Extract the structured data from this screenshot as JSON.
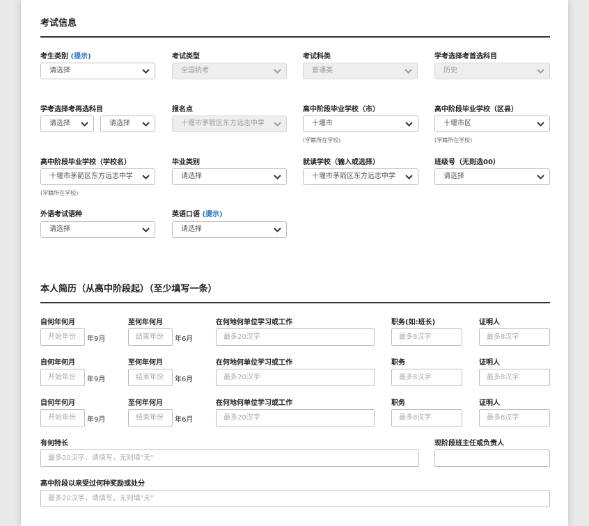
{
  "exam_info": {
    "title": "考试信息",
    "student_category": {
      "label": "考生类别",
      "hint_link": "提示",
      "value": "请选择"
    },
    "exam_type": {
      "label": "考试类型",
      "value": "全国统考"
    },
    "exam_subject": {
      "label": "考试科类",
      "value": "普通类"
    },
    "first_choice": {
      "label": "学考选择考首选科目",
      "value": "历史"
    },
    "second_choice": {
      "label": "学考选择考再选科目",
      "value1": "请选择",
      "value2": "请选择"
    },
    "registration_site": {
      "label": "报名点",
      "value": "十堰市茅箭区东方远志中学"
    },
    "hs_city": {
      "label": "高中阶段毕业学校（市）",
      "value": "十堰市",
      "hint": "(学籍所在学校)"
    },
    "hs_county": {
      "label": "高中阶段毕业学校（区县）",
      "value": "十堰市区",
      "hint": "(学籍所在学校)"
    },
    "hs_school": {
      "label": "高中阶段毕业学校（学校名）",
      "value": "十堰市茅箭区东方远志中学",
      "hint": "(学籍所在学校)"
    },
    "grad_category": {
      "label": "毕业类别",
      "value": "请选择"
    },
    "attend_school": {
      "label": "就读学校（输入或选择）",
      "value": "十堰市茅箭区东方远志中学"
    },
    "class_no": {
      "label": "班级号（无则选00）",
      "value": "请选择"
    },
    "foreign_lang": {
      "label": "外语考试语种",
      "value": "请选择"
    },
    "english_oral": {
      "label": "英语口语",
      "hint_link": "提示",
      "value": "请选择"
    }
  },
  "resume": {
    "title": "本人简历（从高中阶段起）（至少填写一条）",
    "rows": [
      {
        "from_label": "自何年何月",
        "from_placeholder": "开始年份",
        "from_suffix": "年9月",
        "to_label": "至何年何月",
        "to_placeholder": "结束年份",
        "to_suffix": "年6月",
        "where_label": "在何地何单位学习或工作",
        "where_placeholder": "最多20汉字",
        "post_label": "职务(如:班长)",
        "post_placeholder": "最多8汉字",
        "witness_label": "证明人",
        "witness_placeholder": "最多8汉字"
      },
      {
        "from_label": "自何年何月",
        "from_placeholder": "开始年份",
        "from_suffix": "年9月",
        "to_label": "至何年何月",
        "to_placeholder": "结束年份",
        "to_suffix": "年6月",
        "where_label": "在何地何单位学习或工作",
        "where_placeholder": "最多20汉字",
        "post_label": "职务",
        "post_placeholder": "最多8汉字",
        "witness_label": "证明人",
        "witness_placeholder": "最多8汉字"
      },
      {
        "from_label": "自何年何月",
        "from_placeholder": "开始年份",
        "from_suffix": "年9月",
        "to_label": "至何年何月",
        "to_placeholder": "结束年份",
        "to_suffix": "年6月",
        "where_label": "在何地何单位学习或工作",
        "where_placeholder": "最多20汉字",
        "post_label": "职务",
        "post_placeholder": "最多8汉字",
        "witness_label": "证明人",
        "witness_placeholder": "最多8汉字"
      }
    ],
    "specialty": {
      "label": "有何特长",
      "placeholder": "最多20汉字，请填写，无则填\"无\""
    },
    "head_teacher": {
      "label": "现阶段班主任或负责人",
      "value": ""
    },
    "awards": {
      "label": "高中阶段以来受过何种奖励或处分",
      "placeholder": "最多20汉字，请填写，无则填\"无\""
    }
  }
}
